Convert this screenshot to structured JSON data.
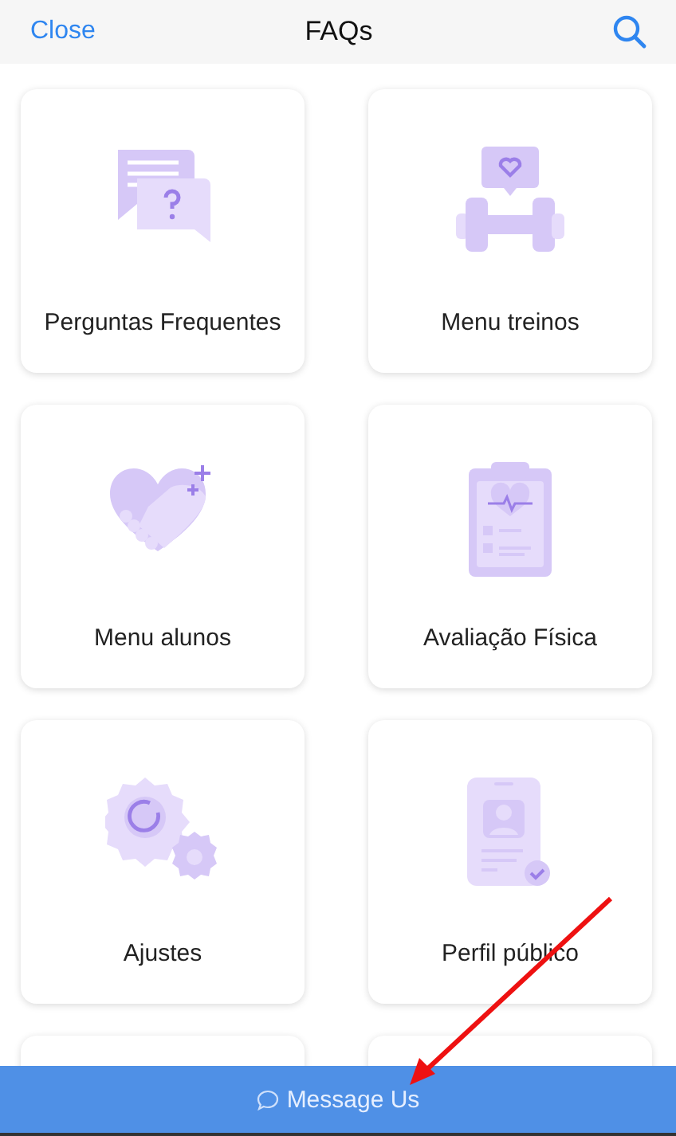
{
  "header": {
    "close": "Close",
    "title": "FAQs"
  },
  "cards": [
    {
      "label": "Perguntas Frequentes",
      "kind": "chat"
    },
    {
      "label": "Menu treinos",
      "kind": "dumbbell"
    },
    {
      "label": "Menu alunos",
      "kind": "handshake"
    },
    {
      "label": "Avaliação Física",
      "kind": "clipboard"
    },
    {
      "label": "Ajustes",
      "kind": "gears"
    },
    {
      "label": "Perfil público",
      "kind": "profile"
    }
  ],
  "footer": {
    "label": "Message Us"
  }
}
